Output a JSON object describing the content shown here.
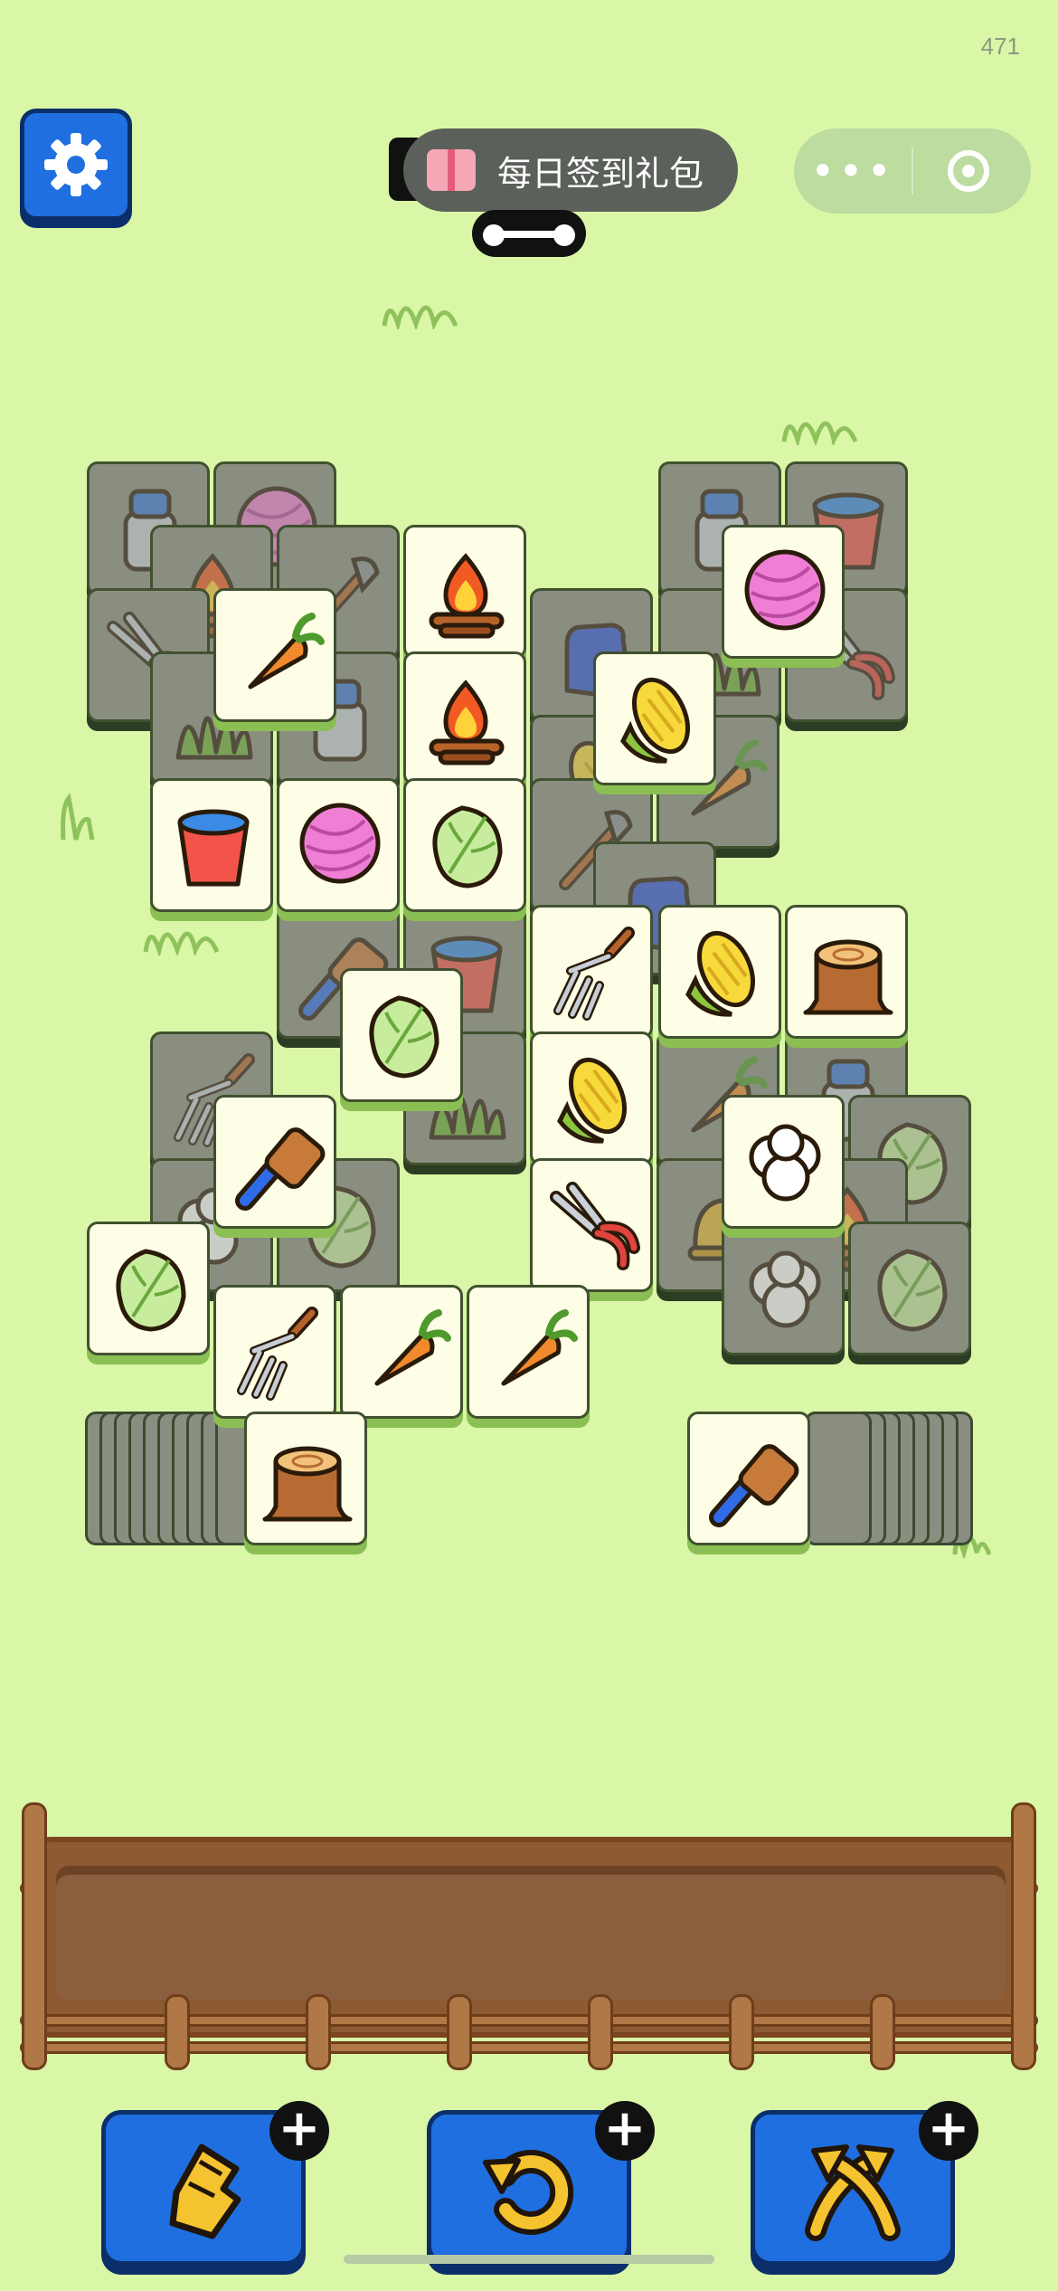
{
  "counter": "471",
  "checkin_label": "每日签到礼包",
  "more_glyph": "•••",
  "plus_glyph": "+",
  "colors": {
    "background": "#d9f7a6",
    "button_blue": "#1f6fe0",
    "tile_face": "#fefde6",
    "tile_dim": "#8a8e80",
    "tray_wood": "#8e5a32"
  },
  "icons": {
    "settings": "gear-icon",
    "gift": "gift-icon",
    "more": "more-dots-icon",
    "record": "record-icon",
    "tool_1": "gold-hand-icon",
    "tool_2": "undo-arrow-icon",
    "tool_3": "shuffle-arrows-icon"
  },
  "tiles": [
    {
      "item": "milk-can",
      "state": "low"
    },
    {
      "item": "yarn",
      "state": "low"
    },
    {
      "item": "milk-can",
      "state": "low"
    },
    {
      "item": "bucket",
      "state": "low"
    },
    {
      "item": "campfire",
      "state": "low"
    },
    {
      "item": "shovel",
      "state": "low"
    },
    {
      "item": "campfire",
      "state": "top"
    },
    {
      "item": "yarn",
      "state": "top"
    },
    {
      "item": "shears",
      "state": "low"
    },
    {
      "item": "carrot",
      "state": "top"
    },
    {
      "item": "glove",
      "state": "low"
    },
    {
      "item": "grass",
      "state": "low"
    },
    {
      "item": "shears",
      "state": "low"
    },
    {
      "item": "grass",
      "state": "low"
    },
    {
      "item": "milk-can",
      "state": "low"
    },
    {
      "item": "campfire",
      "state": "top"
    },
    {
      "item": "corn",
      "state": "low"
    },
    {
      "item": "corn",
      "state": "top"
    },
    {
      "item": "carrot",
      "state": "low"
    },
    {
      "item": "bucket",
      "state": "top"
    },
    {
      "item": "yarn",
      "state": "top"
    },
    {
      "item": "cabbage",
      "state": "top"
    },
    {
      "item": "shovel",
      "state": "low"
    },
    {
      "item": "glove",
      "state": "low"
    },
    {
      "item": "brush",
      "state": "low"
    },
    {
      "item": "bucket",
      "state": "low"
    },
    {
      "item": "fork",
      "state": "top"
    },
    {
      "item": "corn",
      "state": "top"
    },
    {
      "item": "stump",
      "state": "top"
    },
    {
      "item": "cabbage",
      "state": "top"
    },
    {
      "item": "grass",
      "state": "low"
    },
    {
      "item": "fork",
      "state": "low"
    },
    {
      "item": "corn",
      "state": "top"
    },
    {
      "item": "carrot",
      "state": "low"
    },
    {
      "item": "milk-can",
      "state": "low"
    },
    {
      "item": "cabbage",
      "state": "low"
    },
    {
      "item": "brush",
      "state": "top"
    },
    {
      "item": "cotton",
      "state": "top"
    },
    {
      "item": "cotton",
      "state": "low"
    },
    {
      "item": "cabbage",
      "state": "low"
    },
    {
      "item": "shears",
      "state": "top"
    },
    {
      "item": "bell",
      "state": "low"
    },
    {
      "item": "campfire",
      "state": "low"
    },
    {
      "item": "cabbage",
      "state": "low"
    },
    {
      "item": "cabbage",
      "state": "top"
    },
    {
      "item": "cotton",
      "state": "low"
    },
    {
      "item": "fork",
      "state": "top"
    },
    {
      "item": "carrot",
      "state": "top"
    },
    {
      "item": "carrot",
      "state": "top"
    },
    {
      "item": "stump",
      "state": "top"
    },
    {
      "item": "brush",
      "state": "top"
    }
  ]
}
